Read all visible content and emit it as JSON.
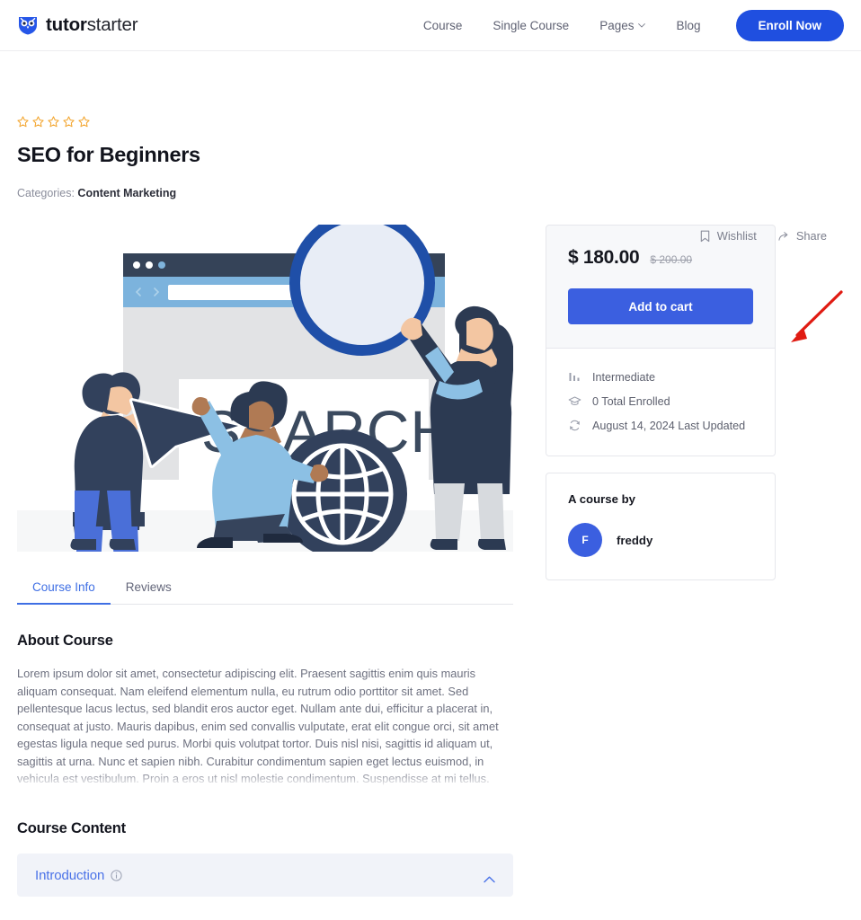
{
  "header": {
    "logo": {
      "icon": "owl-shield-icon",
      "bold_text": "tutor",
      "light_text": "starter"
    },
    "nav": [
      {
        "label": "Course",
        "icon": null
      },
      {
        "label": "Single Course",
        "icon": null
      },
      {
        "label": "Pages",
        "icon": "chevron-down-icon"
      },
      {
        "label": "Blog",
        "icon": null
      }
    ],
    "cta_label": "Enroll Now",
    "accent_color": "#1f4fe0"
  },
  "course": {
    "rating": {
      "stars_total": 5,
      "stars_filled": 0,
      "star_color": "#f3a42c"
    },
    "title": "SEO for Beginners",
    "categories_label": "Categories:",
    "categories_value": "Content Marketing",
    "actions": [
      {
        "label": "Wishlist",
        "icon": "bookmark-icon"
      },
      {
        "label": "Share",
        "icon": "share-arrow-icon"
      }
    ],
    "hero_alt": "SEO illustration with browser window, magnifying glass, globe and people"
  },
  "tabs": [
    {
      "label": "Course Info",
      "active": true
    },
    {
      "label": "Reviews",
      "active": false
    }
  ],
  "about": {
    "heading": "About Course",
    "body": "Lorem ipsum dolor sit amet, consectetur adipiscing elit. Praesent sagittis enim quis mauris aliquam consequat. Nam eleifend elementum nulla, eu rutrum odio porttitor sit amet. Sed pellentesque lacus lectus, sed blandit eros auctor eget. Nullam ante dui, efficitur a placerat in, consequat at justo. Mauris dapibus, enim sed convallis vulputate, erat elit congue orci, sit amet egestas ligula neque sed purus. Morbi quis volutpat tortor. Duis nisl nisi, sagittis id aliquam ut, sagittis at urna. Nunc et sapien nibh. Curabitur condimentum sapien eget lectus euismod, in vehicula est vestibulum. Proin a eros ut nisl molestie condimentum. Suspendisse at mi tellus."
  },
  "course_content": {
    "heading": "Course Content",
    "topics": [
      {
        "label": "Introduction",
        "info_icon": "info-circle-icon",
        "toggle_icon": "chevron-up-icon",
        "expanded": true
      }
    ]
  },
  "pricing": {
    "price": "$ 180.00",
    "old_price": "$ 200.00",
    "cart_label": "Add to cart",
    "cart_color": "#3b5fe0",
    "meta": [
      {
        "icon": "level-bars-icon",
        "label": "Intermediate"
      },
      {
        "icon": "graduation-cap-icon",
        "label": "0 Total Enrolled"
      },
      {
        "icon": "refresh-icon",
        "label": "August 14, 2024 Last Updated"
      }
    ]
  },
  "author": {
    "label": "A course by",
    "avatar_initial": "F",
    "name": "freddy"
  },
  "annotation": {
    "type": "arrow",
    "color": "#e01b12",
    "points_to": "Add to cart"
  }
}
